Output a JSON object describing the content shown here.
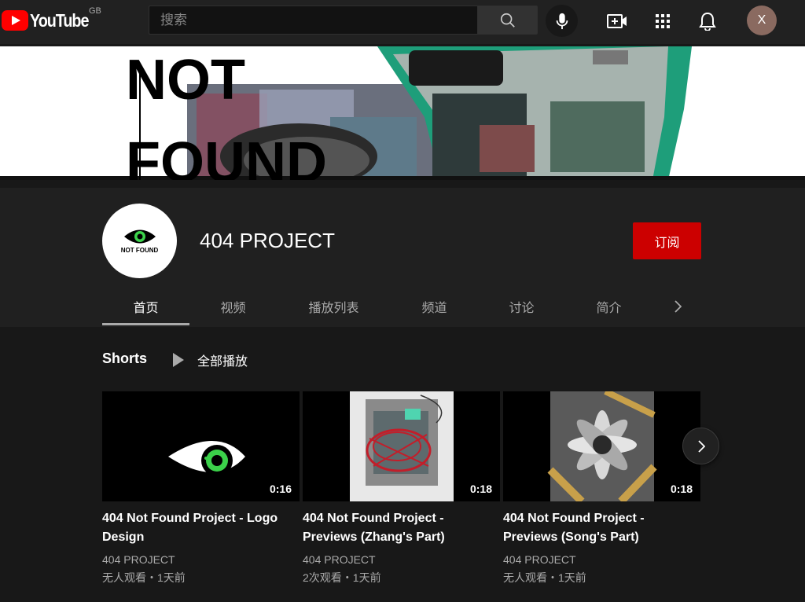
{
  "masthead": {
    "logo_text": "YouTube",
    "region": "GB",
    "search_placeholder": "搜索",
    "avatar_initial": "X",
    "icons": [
      "search-icon",
      "mic-icon",
      "create-video-icon",
      "apps-grid-icon",
      "bell-icon"
    ]
  },
  "banner": {
    "line1": "NOT",
    "line2": "FOUND"
  },
  "channel": {
    "name": "404 PROJECT",
    "avatar_text": "NOT FOUND",
    "subscribe_label": "订阅"
  },
  "tabs": [
    {
      "label": "首页",
      "active": true
    },
    {
      "label": "视频",
      "active": false
    },
    {
      "label": "播放列表",
      "active": false
    },
    {
      "label": "频道",
      "active": false
    },
    {
      "label": "讨论",
      "active": false
    },
    {
      "label": "简介",
      "active": false
    }
  ],
  "shorts": {
    "title": "Shorts",
    "play_all": "全部播放",
    "items": [
      {
        "title": "404 Not Found Project - Logo Design",
        "duration": "0:16",
        "channel": "404 PROJECT",
        "meta": "无人观看・1天前"
      },
      {
        "title": "404 Not Found Project - Previews (Zhang's Part)",
        "duration": "0:18",
        "channel": "404 PROJECT",
        "meta": "2次观看・1天前"
      },
      {
        "title": "404 Not Found Project - Previews (Song's Part)",
        "duration": "0:18",
        "channel": "404 PROJECT",
        "meta": "无人观看・1天前"
      }
    ]
  },
  "colors": {
    "background": "#181818",
    "header_bg": "#202020",
    "subscribe": "#cc0000",
    "eye_green": "#3bd14a"
  }
}
